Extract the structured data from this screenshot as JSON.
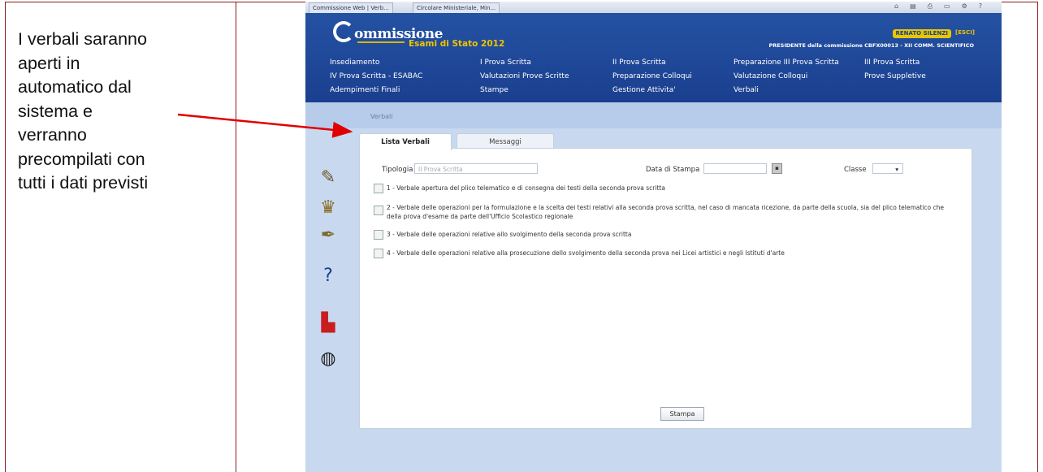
{
  "annotation": {
    "lines": [
      "I verbali saranno",
      "aperti in",
      "automatico dal",
      "sistema e",
      "verranno",
      "precompilati con",
      "tutti i dati previsti"
    ],
    "arrow_color": "#e00000"
  },
  "browser": {
    "tabs": [
      "Commissione Web | Verb...",
      "Circolare Ministeriale, Min..."
    ],
    "icons": [
      "home-icon",
      "feed-icon",
      "print-icon",
      "page-icon",
      "tools-icon",
      "help-icon"
    ]
  },
  "header": {
    "brand": "ommissione",
    "exam_title": "Esami di Stato 2012",
    "user_label": "RENATO SILENZI",
    "logout_label": "[ESCI]",
    "president_label": "PRESIDENTE della commissione CBFX00013 - XII COMM. SCIENTIFICO",
    "accent_color": "#f0c400"
  },
  "menu": {
    "row1": [
      "Insediamento",
      "I Prova Scritta",
      "II Prova Scritta",
      "Preparazione III Prova Scritta",
      "III Prova Scritta"
    ],
    "row2": [
      "IV Prova Scritta - ESABAC",
      "Valutazioni Prove Scritte",
      "Preparazione Colloqui",
      "Valutazione Colloqui",
      "Prove Suppletive"
    ],
    "row3": [
      "Adempimenti Finali",
      "Stampe",
      "Gestione Attivita'",
      "Verbali"
    ]
  },
  "breadcrumb": "Verbali",
  "tabs": {
    "active": "Lista Verbali",
    "other": "Messaggi"
  },
  "filters": {
    "tipologia_label": "Tipologia",
    "tipologia_value": "II Prova Scritta",
    "data_label": "Data di Stampa",
    "classe_label": "Classe"
  },
  "verbali": [
    "1 - Verbale apertura del plico telematico e di consegna dei testi della seconda prova scritta",
    "2 - Verbale delle operazioni per la formulazione e la scelta dei testi relativi alla seconda prova scritta, nel caso di mancata ricezione, da parte della scuola, sia del plico telematico che della prova d'esame da parte dell'Ufficio Scolastico regionale",
    "3 - Verbale delle operazioni relative allo svolgimento della seconda prova scritta",
    "4 - Verbale delle operazioni relative alla prosecuzione dello svolgimento della seconda prova nei Licei artistici e negli Istituti d'arte"
  ],
  "side_icons": [
    "documents-icon",
    "crown-icon",
    "pen-icon",
    "help-icon",
    "pdf-icon",
    "globe-icon"
  ],
  "stampa_label": "Stampa"
}
